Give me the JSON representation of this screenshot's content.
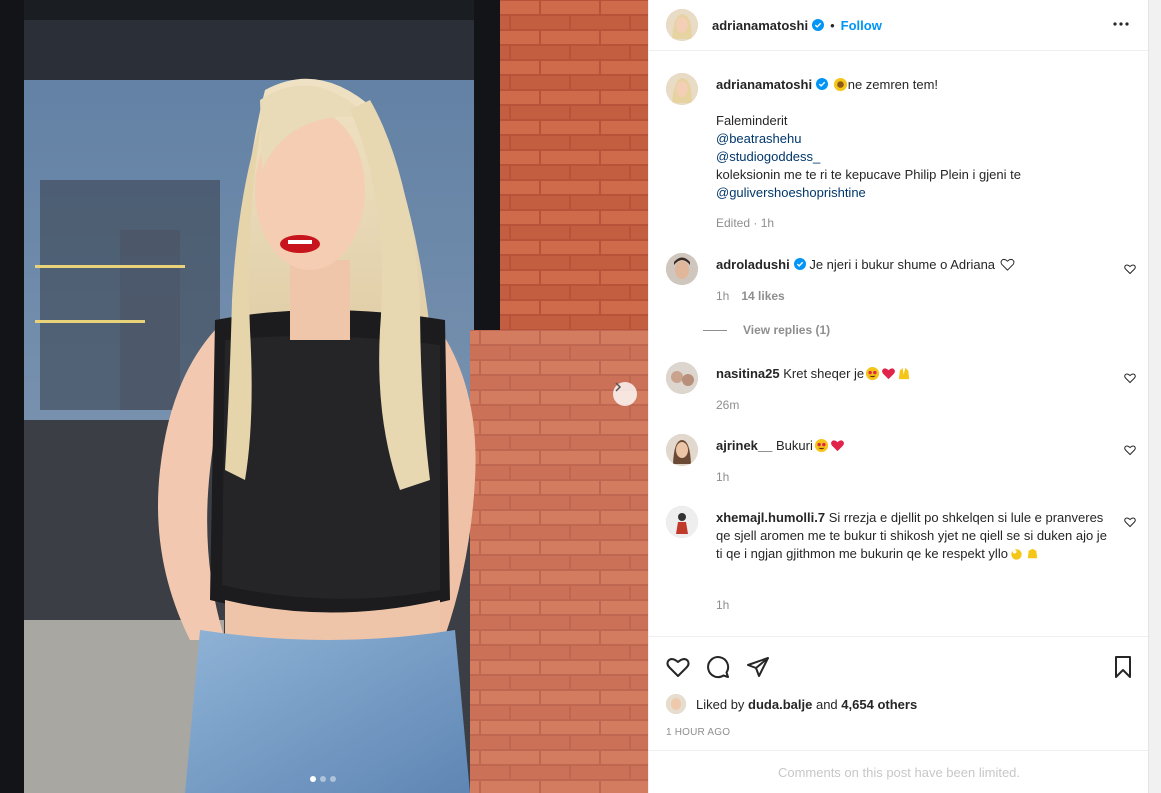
{
  "post": {
    "username": "adrianamatoshi",
    "follow_label": "Follow",
    "separator": "•"
  },
  "caption": {
    "username": "adrianamatoshi",
    "first_line": "ne zemren tem!",
    "line2": "Faleminderit",
    "mention1": "@beatrashehu",
    "mention2": "@studiogoddess_",
    "line5": "koleksionin me te ri te kepucave Philip Plein i gjeni te",
    "mention3": "@gulivershoeshoprishtine",
    "meta": "Edited · 1h"
  },
  "comments": [
    {
      "username": "adroladushi",
      "verified": true,
      "text": "Je njeri i bukur shume o Adriana",
      "time": "1h",
      "likes": "14 likes",
      "view_replies": "View replies (1)"
    },
    {
      "username": "nasitina25",
      "text": "Kret sheqer je",
      "time": "26m"
    },
    {
      "username": "ajrinek__",
      "text": "Bukuri",
      "time": "1h"
    },
    {
      "username": "xhemajl.humolli.7",
      "text": "Si rrezja e djellit po shkelqen si lule e pranveres qe sjell aromen me te bukur ti shikosh yjet ne qiell se si duken ajo je ti qe i ngjan gjithmon me bukurin qe ke respekt yllo",
      "time": "1h"
    }
  ],
  "likes": {
    "prefix": "Liked by",
    "user": "duda.balje",
    "and": "and",
    "others": "4,654 others"
  },
  "timestamp": "1 HOUR AGO",
  "limited_notice": "Comments on this post have been limited.",
  "icons": [
    "heart-icon",
    "comment-icon",
    "share-icon",
    "bookmark-icon",
    "more-icon",
    "verified-icon",
    "chevron-right-icon"
  ],
  "colors": {
    "accent": "#0095f6",
    "mention": "#00376b",
    "muted": "#8e8e8e",
    "verified": "#0095f6",
    "like_red": "#ed4956"
  }
}
